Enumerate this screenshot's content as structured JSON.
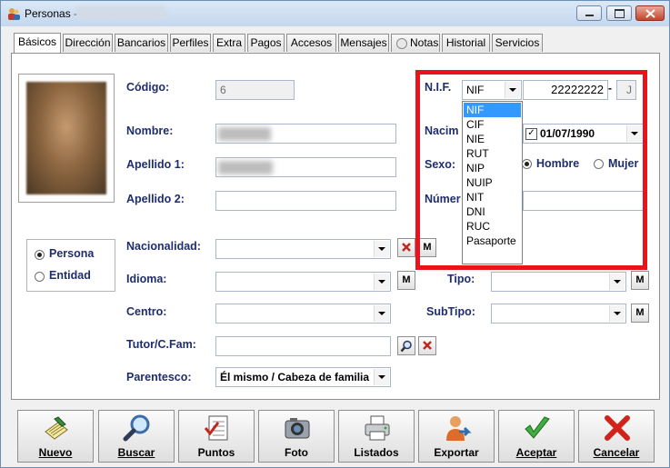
{
  "window": {
    "title": "Personas -"
  },
  "tabs": [
    {
      "label": "Básicos"
    },
    {
      "label": "Dirección"
    },
    {
      "label": "Bancarios"
    },
    {
      "label": "Perfiles"
    },
    {
      "label": "Extra"
    },
    {
      "label": "Pagos"
    },
    {
      "label": "Accesos"
    },
    {
      "label": "Mensajes"
    },
    {
      "label": "Notas"
    },
    {
      "label": "Historial"
    },
    {
      "label": "Servicios"
    }
  ],
  "form": {
    "codigo_label": "Código:",
    "codigo_value": "6",
    "nombre_label": "Nombre:",
    "apellido1_label": "Apellido 1:",
    "apellido2_label": "Apellido 2:",
    "nacionalidad_label": "Nacionalidad:",
    "idioma_label": "Idioma:",
    "centro_label": "Centro:",
    "tutor_label": "Tutor/C.Fam:",
    "parentesco_label": "Parentesco:",
    "parentesco_value": "Él mismo / Cabeza de familia",
    "tipo_label": "Tipo:",
    "subtipo_label": "SubTipo:",
    "m_button": "M"
  },
  "persona_type": {
    "persona_label": "Persona",
    "entidad_label": "Entidad",
    "selected": "Persona"
  },
  "nif": {
    "label": "N.I.F.",
    "type_value": "NIF",
    "number_value": "22222222",
    "dash": "-",
    "letter_value": "J",
    "nacim_label": "Nacim",
    "birthdate_value": "01/07/1990",
    "sexo_label": "Sexo:",
    "hombre_label": "Hombre",
    "mujer_label": "Mujer",
    "sexo_selected": "Hombre",
    "numero_label": "Númer",
    "options": [
      "NIF",
      "CIF",
      "NIE",
      "RUT",
      "NIP",
      "NUIP",
      "NIT",
      "DNI",
      "RUC",
      "Pasaporte"
    ],
    "selected_option": "NIF"
  },
  "toolbar": {
    "buttons": [
      {
        "label": "Nuevo",
        "icon": "new-document-icon"
      },
      {
        "label": "Buscar",
        "icon": "magnifier-icon"
      },
      {
        "label": "Puntos",
        "icon": "checklist-icon"
      },
      {
        "label": "Foto",
        "icon": "camera-icon"
      },
      {
        "label": "Listados",
        "icon": "printer-icon"
      },
      {
        "label": "Exportar",
        "icon": "export-user-icon"
      },
      {
        "label": "Aceptar",
        "icon": "green-check-icon"
      },
      {
        "label": "Cancelar",
        "icon": "red-x-icon"
      }
    ]
  },
  "colors": {
    "label_blue": "#1f2d6e",
    "highlight_red": "#e8131b",
    "selection_blue": "#3399ff"
  }
}
